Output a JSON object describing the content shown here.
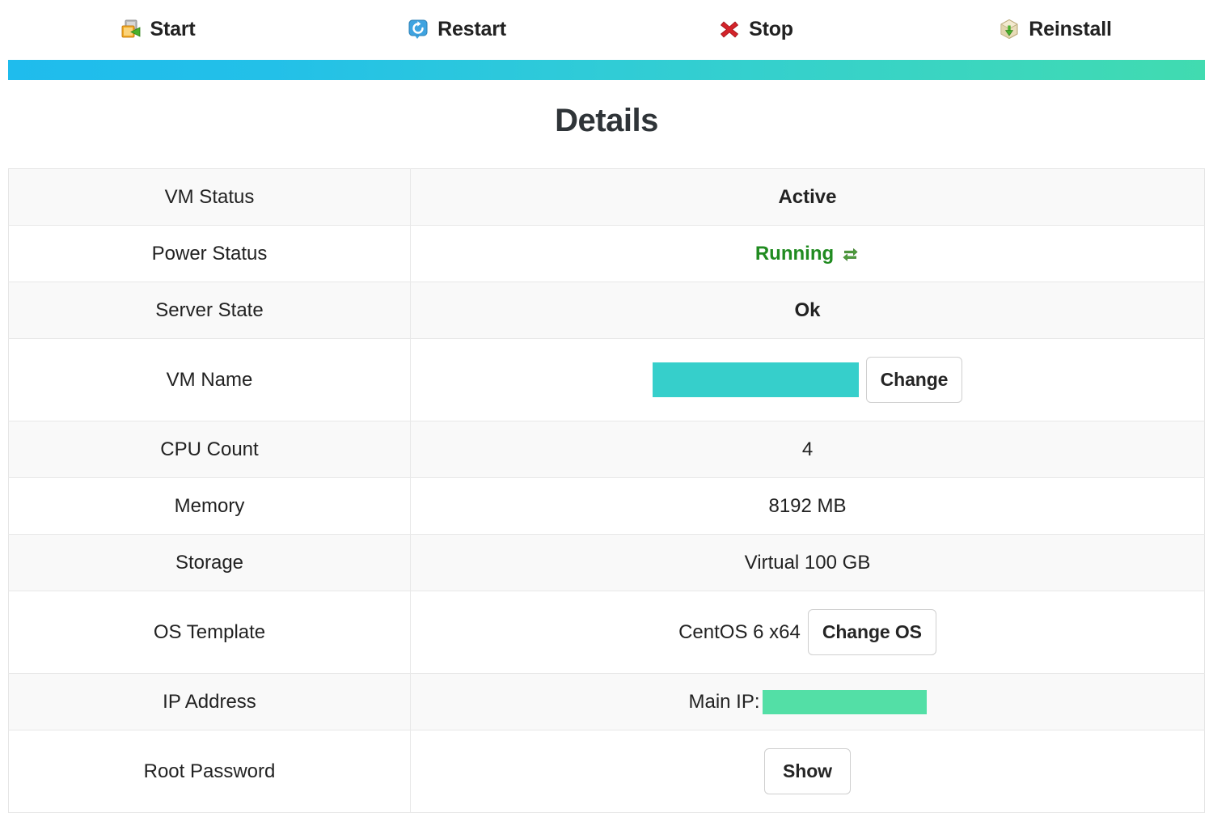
{
  "actions": [
    {
      "label": "Start",
      "icon": "start-icon"
    },
    {
      "label": "Restart",
      "icon": "restart-icon"
    },
    {
      "label": "Stop",
      "icon": "stop-icon"
    },
    {
      "label": "Reinstall",
      "icon": "reinstall-icon"
    }
  ],
  "colors": {
    "gradient_start": "#1fbced",
    "gradient_end": "#41dbb0",
    "running_green": "#208b20",
    "redaction_teal": "#36cfcb",
    "redaction_green": "#53dfa6",
    "stop_red": "#d4232a",
    "border": "#e8e8e8",
    "row_alt": "#f9f9f9"
  },
  "page": {
    "title": "Details"
  },
  "details": {
    "rows": [
      {
        "label": "VM Status",
        "value": "Active",
        "type": "text-bold"
      },
      {
        "label": "Power Status",
        "value": "Running",
        "type": "running"
      },
      {
        "label": "Server State",
        "value": "Ok",
        "type": "text-bold"
      },
      {
        "label": "VM Name",
        "value": "",
        "type": "redacted-change",
        "button": "Change"
      },
      {
        "label": "CPU Count",
        "value": "4",
        "type": "text"
      },
      {
        "label": "Memory",
        "value": "8192 MB",
        "type": "text"
      },
      {
        "label": "Storage",
        "value": "Virtual 100 GB",
        "type": "text"
      },
      {
        "label": "OS Template",
        "value": "CentOS 6 x64",
        "type": "os",
        "button": "Change OS"
      },
      {
        "label": "IP Address",
        "value": "Main IP:",
        "type": "ip"
      },
      {
        "label": "Root Password",
        "value": "",
        "type": "show",
        "button": "Show"
      }
    ]
  }
}
